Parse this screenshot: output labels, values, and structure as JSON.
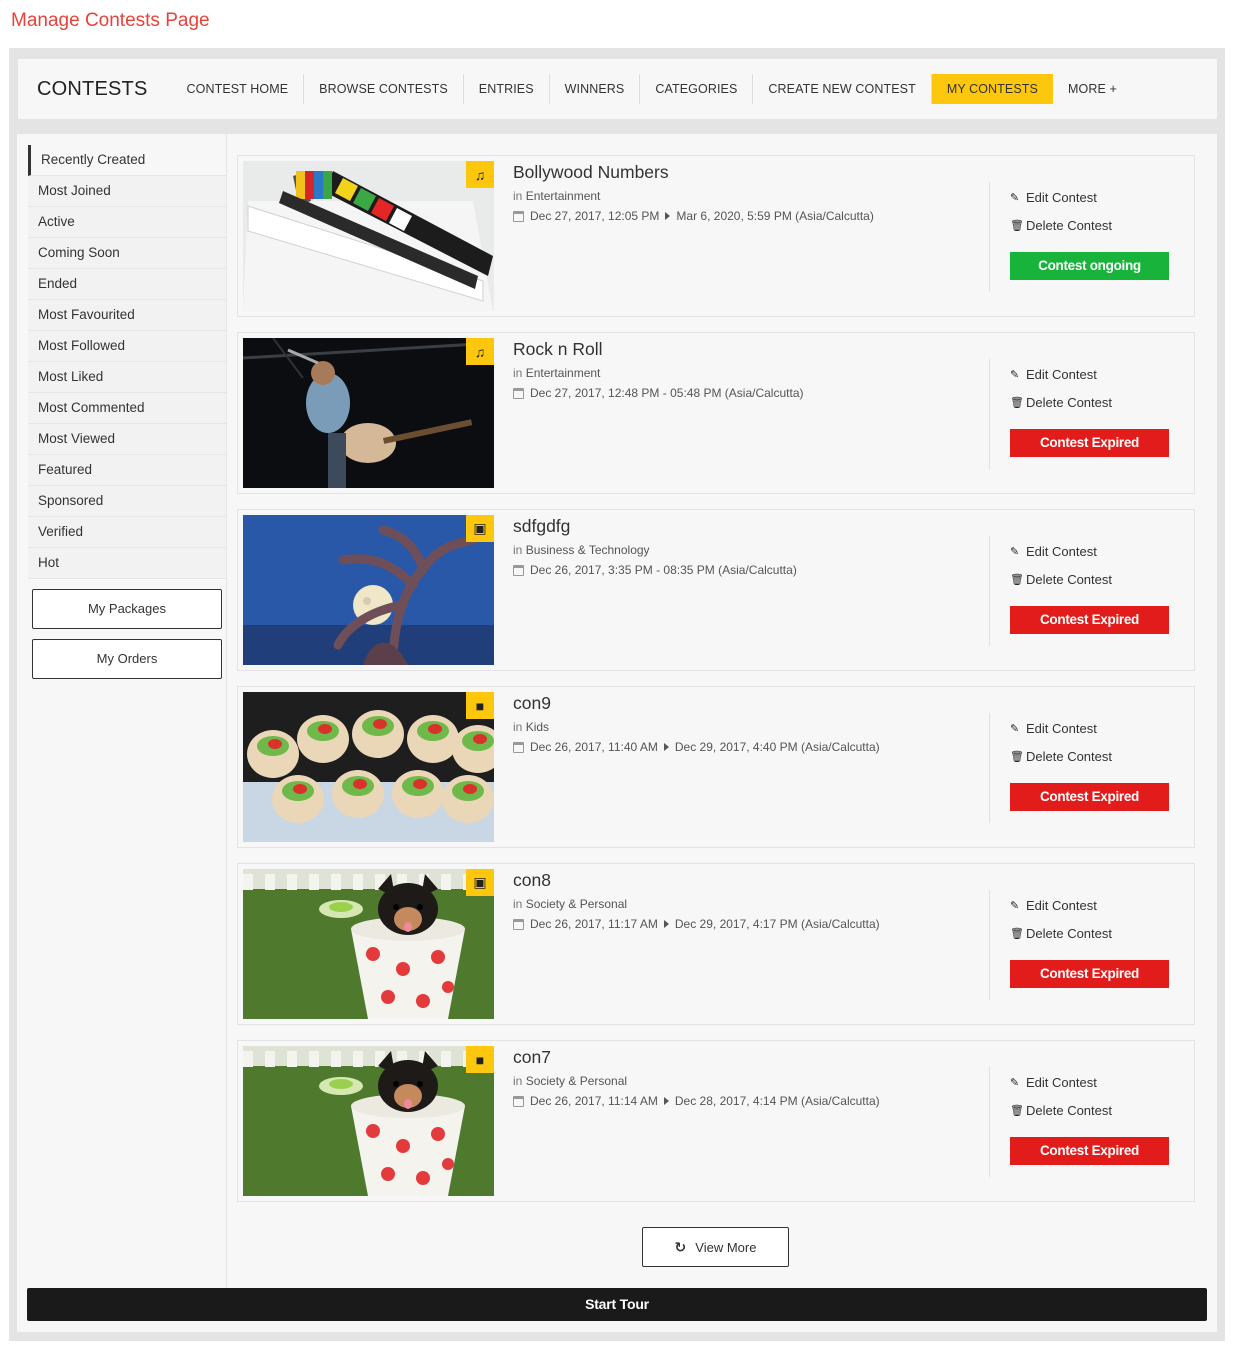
{
  "page_heading": "Manage Contests Page",
  "header": {
    "brand": "CONTESTS",
    "nav": [
      {
        "label": "CONTEST HOME"
      },
      {
        "label": "BROWSE CONTESTS"
      },
      {
        "label": "ENTRIES"
      },
      {
        "label": "WINNERS"
      },
      {
        "label": "CATEGORIES"
      },
      {
        "label": "CREATE NEW CONTEST"
      },
      {
        "label": "MY CONTESTS",
        "active": true
      },
      {
        "label": "MORE +"
      }
    ],
    "active_color": "#fdc70e"
  },
  "sidebar": {
    "items": [
      {
        "label": "Recently Created",
        "active": true
      },
      {
        "label": "Most Joined"
      },
      {
        "label": "Active"
      },
      {
        "label": "Coming Soon"
      },
      {
        "label": "Ended"
      },
      {
        "label": "Most Favourited"
      },
      {
        "label": "Most Followed"
      },
      {
        "label": "Most Liked"
      },
      {
        "label": "Most Commented"
      },
      {
        "label": "Most Viewed"
      },
      {
        "label": "Featured"
      },
      {
        "label": "Sponsored"
      },
      {
        "label": "Verified"
      },
      {
        "label": "Hot"
      }
    ],
    "buttons": {
      "packages": "My Packages",
      "orders": "My Orders"
    }
  },
  "actions": {
    "edit_label": "Edit Contest",
    "delete_label": "Delete Contest",
    "edit_icon": "pencil-icon",
    "delete_icon": "trash-icon"
  },
  "contests": [
    {
      "title": "Bollywood Numbers",
      "in": "in",
      "category": "Entertainment",
      "start": "Dec 27, 2017, 12:05 PM",
      "end": "Mar 6, 2020, 5:59 PM (Asia/Calcutta)",
      "separator": "arrow",
      "type_icon": "music-icon",
      "status": "Contest ongoing",
      "status_kind": "ongoing",
      "image": "clapperboard"
    },
    {
      "title": "Rock n Roll",
      "in": "in",
      "category": "Entertainment",
      "start": "Dec 27, 2017, 12:48 PM",
      "end": "05:48 PM (Asia/Calcutta)",
      "separator": "dash",
      "type_icon": "music-icon",
      "status": "Contest Expired",
      "status_kind": "expired",
      "image": "singer"
    },
    {
      "title": "sdfgdfg",
      "in": "in",
      "category": "Business & Technology",
      "start": "Dec 26, 2017, 3:35 PM",
      "end": "08:35 PM (Asia/Calcutta)",
      "separator": "dash",
      "type_icon": "photo-icon",
      "status": "Contest Expired",
      "status_kind": "expired",
      "image": "tree-moon"
    },
    {
      "title": "con9",
      "in": "in",
      "category": "Kids",
      "start": "Dec 26, 2017, 11:40 AM",
      "end": "Dec 29, 2017, 4:40 PM (Asia/Calcutta)",
      "separator": "arrow",
      "type_icon": "video-icon",
      "status": "Contest Expired",
      "status_kind": "expired",
      "image": "wraps"
    },
    {
      "title": "con8",
      "in": "in",
      "category": "Society & Personal",
      "start": "Dec 26, 2017, 11:17 AM",
      "end": "Dec 29, 2017, 4:17 PM (Asia/Calcutta)",
      "separator": "arrow",
      "type_icon": "photo-icon",
      "status": "Contest Expired",
      "status_kind": "expired",
      "image": "puppy"
    },
    {
      "title": "con7",
      "in": "in",
      "category": "Society & Personal",
      "start": "Dec 26, 2017, 11:14 AM",
      "end": "Dec 28, 2017, 4:14 PM (Asia/Calcutta)",
      "separator": "arrow",
      "type_icon": "video-icon",
      "status": "Contest Expired",
      "status_kind": "expired",
      "image": "puppy"
    }
  ],
  "colors": {
    "ongoing": "#17b33a",
    "expired": "#e21b1b",
    "heading": "#e8423a"
  },
  "view_more": {
    "label": "View More",
    "icon": "refresh-icon"
  },
  "start_tour": "Start Tour"
}
